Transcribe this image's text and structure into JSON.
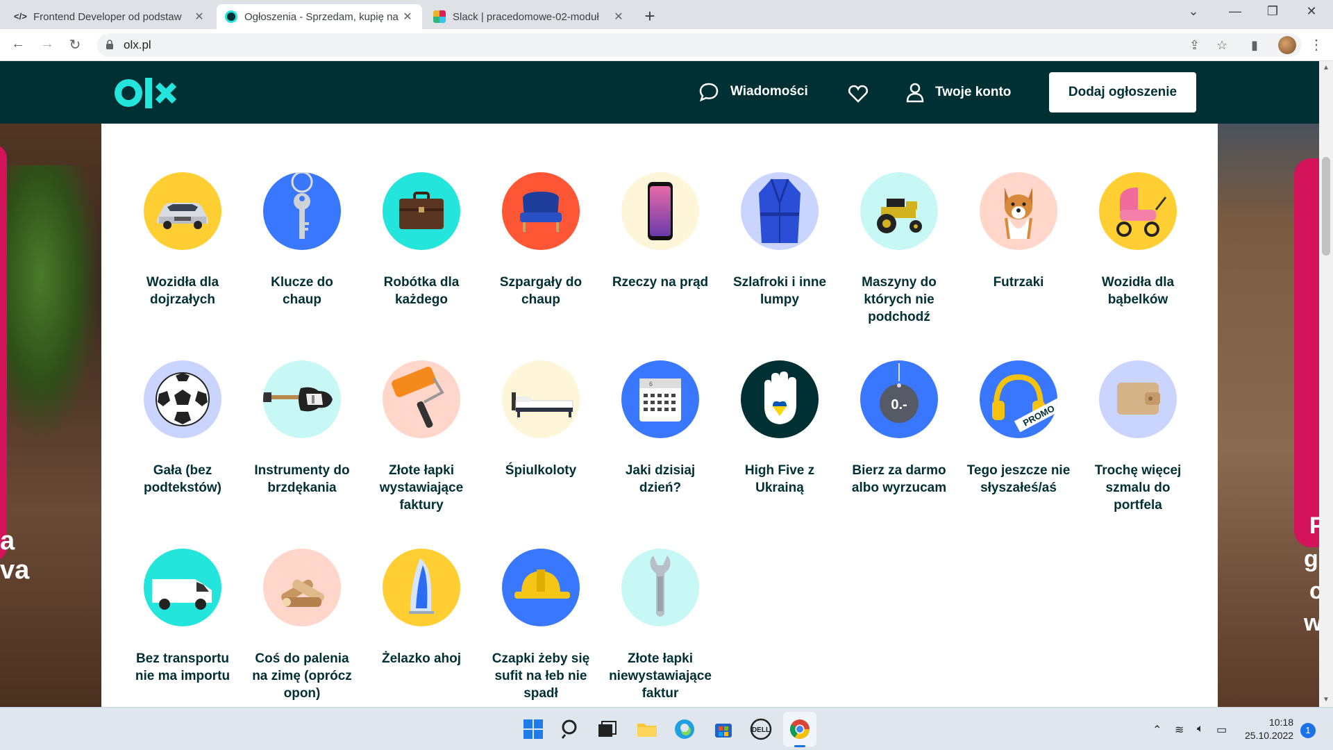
{
  "browser": {
    "tabs": [
      {
        "title": "Frontend Developer od podstaw"
      },
      {
        "title": "Ogłoszenia - Sprzedam, kupię na"
      },
      {
        "title": "Slack | pracedomowe-02-moduł"
      }
    ],
    "url": "olx.pl"
  },
  "header": {
    "logo_text": "olx",
    "messages_label": "Wiadomości",
    "account_label": "Twoje konto",
    "post_ad_label": "Dodaj ogłoszenie"
  },
  "background": {
    "left_text": [
      "a",
      "va"
    ],
    "right_text": [
      "P",
      "go",
      "c",
      "w"
    ]
  },
  "categories": [
    {
      "label": "Wozidła dla dojrzałych",
      "icon": "car-icon",
      "bg": "#ffce32"
    },
    {
      "label": "Klucze do chaup",
      "icon": "key-icon",
      "bg": "#3a77ff"
    },
    {
      "label": "Robótka dla każdego",
      "icon": "briefcase-icon",
      "bg": "#23e5db"
    },
    {
      "label": "Szpargały do chaup",
      "icon": "armchair-icon",
      "bg": "#ff5636"
    },
    {
      "label": "Rzeczy na prąd",
      "icon": "smartphone-icon",
      "bg": "#fff6d9"
    },
    {
      "label": "Szlafroki i inne lumpy",
      "icon": "bathrobe-icon",
      "bg": "#cad5ff"
    },
    {
      "label": "Maszyny do których nie podchodź",
      "icon": "tractor-icon",
      "bg": "#c8f8f6"
    },
    {
      "label": "Futrzaki",
      "icon": "dog-icon",
      "bg": "#ffd6c9"
    },
    {
      "label": "Wozidła dla bąbelków",
      "icon": "stroller-icon",
      "bg": "#ffce32"
    },
    {
      "label": "Gała (bez podtekstów)",
      "icon": "football-icon",
      "bg": "#cad5ff"
    },
    {
      "label": "Instrumenty do brzdękania",
      "icon": "guitar-icon",
      "bg": "#c8f8f6"
    },
    {
      "label": "Złote łapki wystawiające faktury",
      "icon": "paint-roller-icon",
      "bg": "#ffd6c9"
    },
    {
      "label": "Śpiulkoloty",
      "icon": "bed-icon",
      "bg": "#fff6d9"
    },
    {
      "label": "Jaki dzisiaj dzień?",
      "icon": "calendar-icon",
      "bg": "#3a77ff"
    },
    {
      "label": "High Five z Ukrainą",
      "icon": "ukraine-hand-icon",
      "bg": "#002f34"
    },
    {
      "label": "Bierz za darmo albo wyrzucam",
      "icon": "free-tag-icon",
      "bg": "#3a77ff"
    },
    {
      "label": "Tego jeszcze nie słyszałeś/aś",
      "icon": "headphones-promo-icon",
      "bg": "#3a77ff",
      "badge": "PROMO"
    },
    {
      "label": "Trochę więcej szmalu do portfela",
      "icon": "wallet-icon",
      "bg": "#cad5ff"
    },
    {
      "label": "Bez transportu nie ma importu",
      "icon": "van-icon",
      "bg": "#23e5db"
    },
    {
      "label": "Coś do palenia na zimę (oprócz opon)",
      "icon": "firewood-icon",
      "bg": "#ffd6c9"
    },
    {
      "label": "Żelazko ahoj",
      "icon": "iron-icon",
      "bg": "#ffce32"
    },
    {
      "label": "Czapki żeby się sufit na łeb nie spadł",
      "icon": "hard-hat-icon",
      "bg": "#3a77ff"
    },
    {
      "label": "Złote łapki niewystawiające faktur",
      "icon": "wrench-icon",
      "bg": "#c8f8f6"
    }
  ],
  "free_tag_text": "0.-",
  "calendar_day": "6",
  "taskbar": {
    "time": "10:18",
    "date": "25.10.2022",
    "notifications": "1"
  }
}
